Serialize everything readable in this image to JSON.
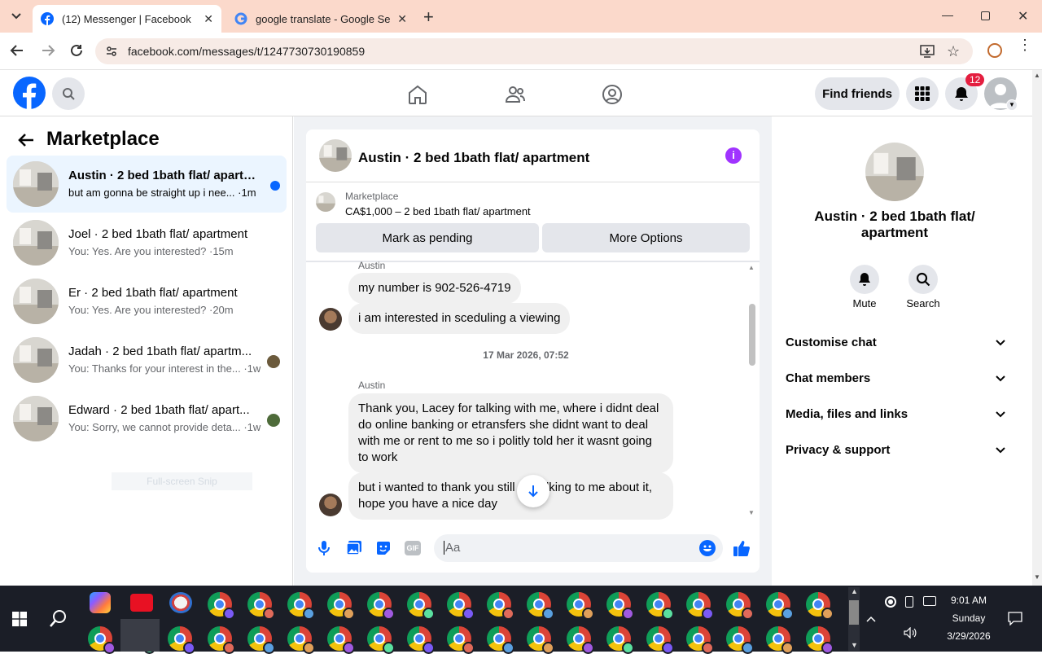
{
  "browser": {
    "tabs": [
      {
        "title": "(12) Messenger | Facebook"
      },
      {
        "title": "google translate - Google Searc"
      }
    ],
    "url": "facebook.com/messages/t/1247730730190859"
  },
  "fb_header": {
    "find_friends": "Find friends",
    "notification_count": "12"
  },
  "sidebar": {
    "title": "Marketplace",
    "conversations": [
      {
        "name": "Austin · 2 bed 1bath flat/ apartm...",
        "snippet": "but am gonna be straight up i nee... ·1m",
        "unread": true
      },
      {
        "name": "Joel · 2 bed 1bath flat/ apartment",
        "snippet": "You: Yes. Are you interested? ·15m"
      },
      {
        "name": "Er · 2 bed 1bath flat/ apartment",
        "snippet": "You: Yes. Are you interested? ·20m"
      },
      {
        "name": "Jadah · 2 bed 1bath flat/ apartm...",
        "snippet": "You: Thanks for your interest in the... ·1w"
      },
      {
        "name": "Edward · 2 bed 1bath flat/ apart...",
        "snippet": "You: Sorry, we cannot provide deta... ·1w"
      }
    ],
    "overlay_text": "Full-screen Snip"
  },
  "chat": {
    "title": "Austin · 2 bed 1bath flat/ apartment",
    "listing": {
      "source": "Marketplace",
      "detail": "CA$1,000 – 2 bed 1bath flat/ apartment"
    },
    "mark_pending": "Mark as pending",
    "more_options": "More Options",
    "sender_label_1": "Austin",
    "msg1": "my number is 902-526-4719",
    "msg2": "i am interested in sceduling a viewing",
    "timestamp": "17 Mar 2026, 07:52",
    "sender_label_2": "Austin",
    "msg3": "Thank you, Lacey for talking with me, where i didnt deal do online banking or etransfers she didnt want to deal with me or rent to me so  i politly told her it wasnt going to work",
    "msg4": "but i wanted to thank you still for talking to me about it, hope you have a nice day",
    "composer_placeholder": "Aa"
  },
  "details": {
    "name": "Austin · 2 bed 1bath flat/ apartment",
    "mute": "Mute",
    "search": "Search",
    "sections": [
      "Customise chat",
      "Chat members",
      "Media, files and links",
      "Privacy & support"
    ]
  },
  "tray": {
    "time": "9:01 AM",
    "day": "Sunday",
    "date": "3/29/2026"
  },
  "colors": {
    "tabbar": "#fbd9cb",
    "fb_blue": "#0866ff",
    "info_purple": "#a033ff",
    "taskbar": "#1b1e27"
  }
}
